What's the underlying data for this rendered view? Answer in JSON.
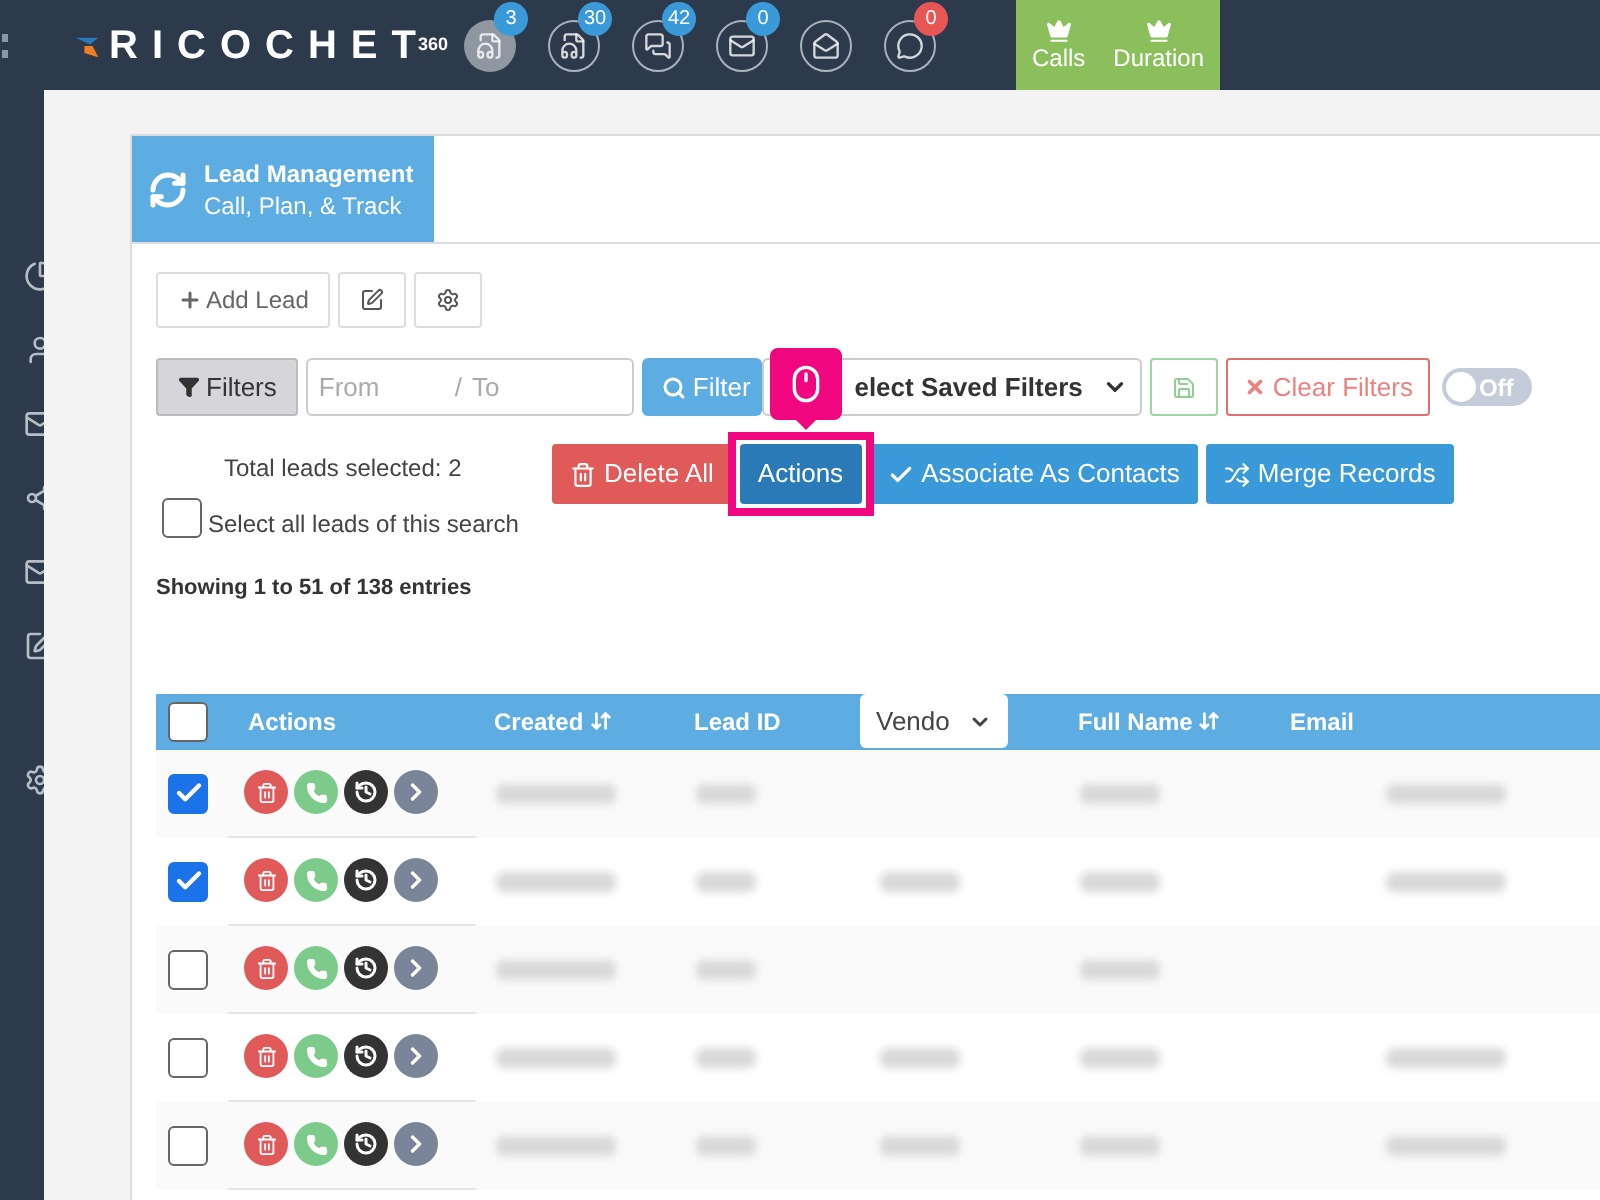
{
  "brand": {
    "name": "RICOCHET",
    "superscript": "360"
  },
  "nav_icons": [
    {
      "kind": "voicemail",
      "count": "3",
      "selected": true,
      "color": "#3a9ad9"
    },
    {
      "kind": "voicemail",
      "count": "30",
      "selected": false,
      "color": "#3a9ad9"
    },
    {
      "kind": "chat",
      "count": "42",
      "selected": false,
      "color": "#3a9ad9"
    },
    {
      "kind": "mail",
      "count": "0",
      "selected": false,
      "color": "#3a9ad9"
    },
    {
      "kind": "mail-open",
      "selected": false
    },
    {
      "kind": "comment",
      "count": "0",
      "selected": false,
      "color": "#e85555"
    }
  ],
  "nav_tabs": [
    {
      "label": "Calls"
    },
    {
      "label": "Duration"
    }
  ],
  "panel": {
    "title": "Lead Management",
    "subtitle": "Call, Plan, & Track"
  },
  "toolbar": {
    "add_lead": "Add Lead"
  },
  "filters": {
    "filters_button": "Filters",
    "from_placeholder": "From",
    "separator": "/",
    "to_placeholder": "To",
    "filter_button": "Filter",
    "saved_filters": "elect Saved Filters",
    "clear_filters": "Clear Filters",
    "toggle": {
      "label": "Off",
      "on": false
    }
  },
  "selection": {
    "total": "Total leads selected: 2",
    "select_all": "Select all leads of this search",
    "select_all_checked": false
  },
  "bulk_buttons": [
    {
      "kind": "delete",
      "label": "Delete All"
    },
    {
      "kind": "actions",
      "label": "Actions",
      "highlighted": true
    },
    {
      "kind": "associate",
      "label": "Associate As Contacts"
    },
    {
      "kind": "merge",
      "label": "Merge Records"
    }
  ],
  "showing": "Showing 1 to 51 of 138 entries",
  "table": {
    "header_checked": false,
    "columns": [
      {
        "label": "Actions",
        "sortable": false
      },
      {
        "label": "Created",
        "sortable": true
      },
      {
        "label": "Lead ID",
        "sortable": false
      },
      {
        "label": "Vendo",
        "kind": "select"
      },
      {
        "label": "Full Name",
        "sortable": true
      },
      {
        "label": "Email",
        "sortable": false
      }
    ],
    "rows": [
      {
        "checked": true,
        "blurred": [
          true,
          true,
          false,
          true,
          true
        ]
      },
      {
        "checked": true,
        "blurred": [
          true,
          true,
          true,
          true,
          true
        ]
      },
      {
        "checked": false,
        "blurred": [
          true,
          true,
          false,
          true,
          false
        ]
      },
      {
        "checked": false,
        "blurred": [
          true,
          true,
          true,
          true,
          true
        ]
      },
      {
        "checked": false,
        "blurred": [
          true,
          true,
          true,
          true,
          true
        ]
      }
    ]
  }
}
